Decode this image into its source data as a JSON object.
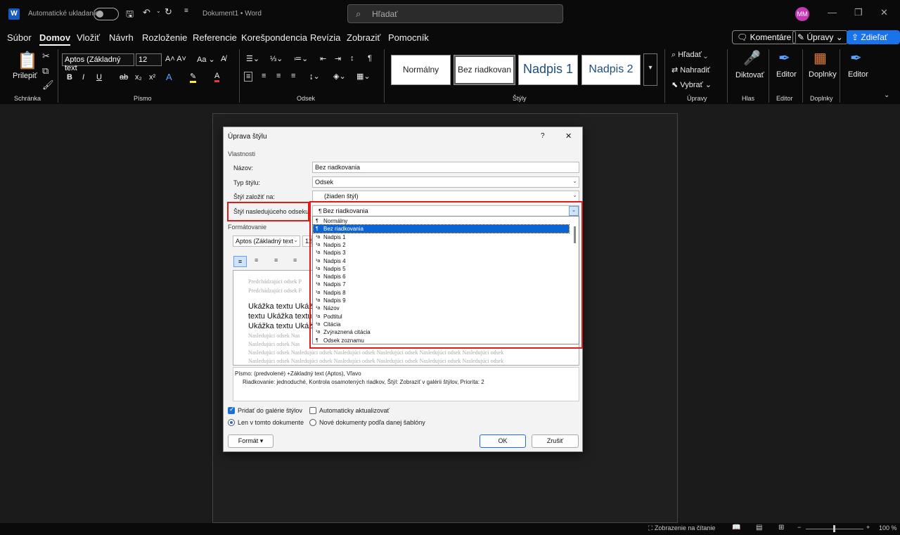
{
  "titlebar": {
    "autosave_label": "Automatické ukladanie",
    "doc_title": "Dokument1 • Word",
    "search_placeholder": "Hľadať",
    "avatar_initials": "MM"
  },
  "menu": [
    "Súbor",
    "Domov",
    "Vložiť",
    "Návrh",
    "Rozloženie",
    "Referencie",
    "Korešpondencia",
    "Revízia",
    "Zobraziť",
    "Pomocník"
  ],
  "menu_right": {
    "comments": "Komentáre",
    "editing": "Úpravy",
    "share": "Zdieľať"
  },
  "ribbon": {
    "paste_label": "Prilepiť",
    "font_name": "Aptos (Základný text",
    "font_size": "12",
    "styles": [
      "Normálny",
      "Bez riadkovan",
      "Nadpis 1",
      "Nadpis 2"
    ],
    "find": "Hľadať",
    "replace": "Nahradiť",
    "select": "Vybrať",
    "dictate": "Diktovať",
    "editor": "Editor",
    "addins": "Doplnky",
    "editor2": "Editor",
    "groups": [
      "Schránka",
      "Písmo",
      "Odsek",
      "Štýly",
      "Úpravy",
      "Hlas",
      "Editor",
      "Doplnky"
    ]
  },
  "dialog": {
    "title": "Úprava štýlu",
    "help": "?",
    "close": "✕",
    "section_properties": "Vlastnosti",
    "name_label": "Názov:",
    "name_value": "Bez riadkovania",
    "type_label": "Typ štýlu:",
    "type_value": "Odsek",
    "based_label": "Štýl založiť na:",
    "based_value": "(žiaden štýl)",
    "next_label": "Štýl nasledujúceho odseku:",
    "next_value": "Bez riadkovania",
    "section_formatting": "Formátovanie",
    "fmt_font": "Aptos (Základný text",
    "fmt_size": "12",
    "preview_prev1": "Predchádzajúci odsek P",
    "preview_prev2": "Predchádzajúci odsek P",
    "preview_sample1": "Ukážka textu Ukážk",
    "preview_sample2": "textu Ukážka textu",
    "preview_sample3": "Ukážka textu Ukážk",
    "preview_next1": "Nasledujúci odsek Nas",
    "preview_next2": "Nasledujúci odsek Nas",
    "preview_next3": "Nasledujúci odsek Nasledujúci odsek Nasledujúci odsek Nasledujúci odsek Nasledujúci odsek Nasledujúci odsek",
    "preview_next4": "Nasledujúci odsek Nasledujúci odsek Nasledujúci odsek Nasledujúci odsek Nasledujúci odsek Nasledujúci odsek",
    "desc_line1": "Písmo: (predvolené) +Základný text (Aptos), Vľavo",
    "desc_line2": "Riadkovanie:  jednoduché, Kontrola osamotených riadkov, Štýl: Zobraziť v galérii štýlov, Priorita: 2",
    "add_gallery": "Pridať do galérie štýlov",
    "auto_update": "Automaticky aktualizovať",
    "only_doc": "Len v tomto dokumente",
    "new_docs": "Nové dokumenty podľa danej šablóny",
    "format_btn": "Formát",
    "ok": "OK",
    "cancel": "Zrušiť"
  },
  "dropdown_items": [
    "Normálny",
    "Bez riadkovania",
    "Nadpis 1",
    "Nadpis 2",
    "Nadpis 3",
    "Nadpis 4",
    "Nadpis 5",
    "Nadpis 6",
    "Nadpis 7",
    "Nadpis 8",
    "Nadpis 9",
    "Názov",
    "Podtitul",
    "Citácia",
    "Zvýraznená citácia",
    "Odsek zoznamu"
  ],
  "status": {
    "focus": "Zobrazenie na čítanie",
    "zoom": "100 %"
  },
  "colors": {
    "highlight_red": "#e01b1b",
    "selection_blue": "#0a64d6"
  }
}
